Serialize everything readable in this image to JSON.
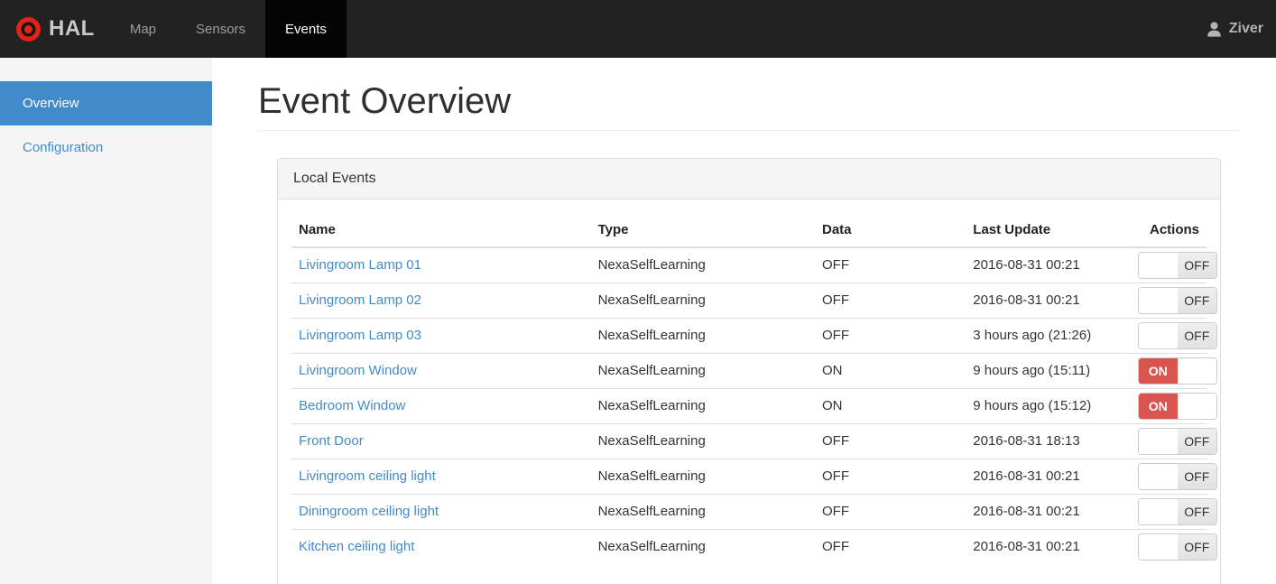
{
  "navbar": {
    "brand": "HAL",
    "items": [
      {
        "label": "Map",
        "active": false
      },
      {
        "label": "Sensors",
        "active": false
      },
      {
        "label": "Events",
        "active": true
      }
    ],
    "user": "Ziver"
  },
  "sidebar": {
    "items": [
      {
        "label": "Overview",
        "active": true
      },
      {
        "label": "Configuration",
        "active": false
      }
    ]
  },
  "main": {
    "title": "Event Overview",
    "panel": {
      "title": "Local Events",
      "table": {
        "columns": [
          "Name",
          "Type",
          "Data",
          "Last Update",
          "Actions"
        ],
        "rows": [
          {
            "name": "Livingroom Lamp 01",
            "type": "NexaSelfLearning",
            "data": "OFF",
            "last_update": "2016-08-31 00:21",
            "toggle": "OFF"
          },
          {
            "name": "Livingroom Lamp 02",
            "type": "NexaSelfLearning",
            "data": "OFF",
            "last_update": "2016-08-31 00:21",
            "toggle": "OFF"
          },
          {
            "name": "Livingroom Lamp 03",
            "type": "NexaSelfLearning",
            "data": "OFF",
            "last_update": "3 hours ago (21:26)",
            "toggle": "OFF"
          },
          {
            "name": "Livingroom Window",
            "type": "NexaSelfLearning",
            "data": "ON",
            "last_update": "9 hours ago (15:11)",
            "toggle": "ON"
          },
          {
            "name": "Bedroom Window",
            "type": "NexaSelfLearning",
            "data": "ON",
            "last_update": "9 hours ago (15:12)",
            "toggle": "ON"
          },
          {
            "name": "Front Door",
            "type": "NexaSelfLearning",
            "data": "OFF",
            "last_update": "2016-08-31 18:13",
            "toggle": "OFF"
          },
          {
            "name": "Livingroom ceiling light",
            "type": "NexaSelfLearning",
            "data": "OFF",
            "last_update": "2016-08-31 00:21",
            "toggle": "OFF"
          },
          {
            "name": "Diningroom ceiling light",
            "type": "NexaSelfLearning",
            "data": "OFF",
            "last_update": "2016-08-31 00:21",
            "toggle": "OFF"
          },
          {
            "name": "Kitchen ceiling light",
            "type": "NexaSelfLearning",
            "data": "OFF",
            "last_update": "2016-08-31 00:21",
            "toggle": "OFF"
          }
        ]
      }
    }
  },
  "toggle_labels": {
    "on": "ON",
    "off": "OFF"
  },
  "colors": {
    "navbar_bg": "#222222",
    "navbar_active_bg": "#040404",
    "accent_blue": "#428bca",
    "toggle_on_red": "#d9534f",
    "logo_red": "#e32219",
    "panel_border": "#dddddd",
    "sidebar_bg": "#f5f5f5"
  }
}
